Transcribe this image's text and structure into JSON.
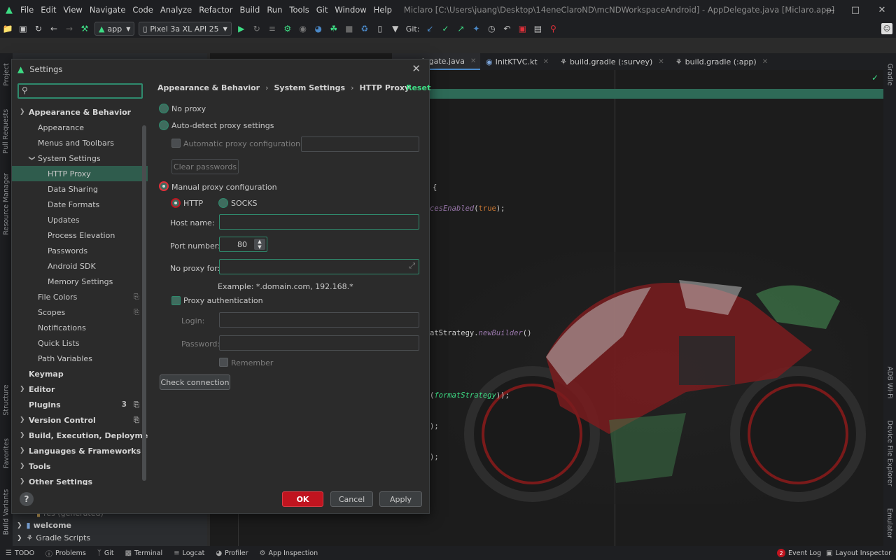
{
  "menubar": {
    "items": [
      "File",
      "Edit",
      "View",
      "Navigate",
      "Code",
      "Analyze",
      "Refactor",
      "Build",
      "Run",
      "Tools",
      "Git",
      "Window",
      "Help"
    ],
    "title": "Miclaro [C:\\Users\\juang\\Desktop\\14eneClaroND\\mcNDWorkspaceAndroid] - AppDelegate.java [Miclaro.app]"
  },
  "toolbar": {
    "module": "app",
    "device": "Pixel 3a XL API 25",
    "git_label": "Git:"
  },
  "left_stripe": [
    "Project",
    "Pull Requests",
    "Resource Manager",
    "Structure",
    "Favorites",
    "Build Variants"
  ],
  "right_stripe": [
    "Gradle",
    "ADB Wi-Fi",
    "Device File Explorer",
    "Emulator"
  ],
  "editor_tabs": [
    {
      "label": "elegate.java"
    },
    {
      "label": "InitKTVC.kt"
    },
    {
      "label": "build.gradle (:survey)"
    },
    {
      "label": "build.gradle (:app)"
    }
  ],
  "code_lines": [
    {
      "text": "{"
    },
    {
      "text": "cesEnabled(true);"
    },
    {
      "text": "atStrategy.newBuilder()"
    },
    {
      "text": "(formatStrategy));"
    },
    {
      "text": ");"
    },
    {
      "text": ");"
    }
  ],
  "project_tree": {
    "res_generated": "res (generated)",
    "welcome": "welcome",
    "gradle_scripts": "Gradle Scripts"
  },
  "dialog": {
    "title": "Settings",
    "sidebar": [
      {
        "label": "Appearance & Behavior",
        "bold": true,
        "expanded": true
      },
      {
        "label": "Appearance"
      },
      {
        "label": "Menus and Toolbars"
      },
      {
        "label": "System Settings",
        "expanded": true
      },
      {
        "label": "HTTP Proxy",
        "selected": true
      },
      {
        "label": "Data Sharing"
      },
      {
        "label": "Date Formats"
      },
      {
        "label": "Updates"
      },
      {
        "label": "Process Elevation"
      },
      {
        "label": "Passwords"
      },
      {
        "label": "Android SDK"
      },
      {
        "label": "Memory Settings"
      },
      {
        "label": "File Colors"
      },
      {
        "label": "Scopes"
      },
      {
        "label": "Notifications"
      },
      {
        "label": "Quick Lists"
      },
      {
        "label": "Path Variables"
      },
      {
        "label": "Keymap",
        "bold": true
      },
      {
        "label": "Editor",
        "bold": true
      },
      {
        "label": "Plugins",
        "bold": true,
        "count": "3"
      },
      {
        "label": "Version Control",
        "bold": true
      },
      {
        "label": "Build, Execution, Deployment",
        "bold": true
      },
      {
        "label": "Languages & Frameworks",
        "bold": true
      },
      {
        "label": "Tools",
        "bold": true
      },
      {
        "label": "Other Settings",
        "bold": true
      }
    ],
    "breadcrumb": [
      "Appearance & Behavior",
      "System Settings",
      "HTTP Proxy"
    ],
    "reset": "Reset",
    "no_proxy": "No proxy",
    "auto_detect": "Auto-detect proxy settings",
    "auto_config_url": "Automatic proxy configuration URL:",
    "clear_passwords": "Clear passwords",
    "manual": "Manual proxy configuration",
    "http": "HTTP",
    "socks": "SOCKS",
    "host_name_label": "Host name:",
    "host_name_value": "",
    "port_label": "Port number:",
    "port_value": "80",
    "no_proxy_for_label": "No proxy for:",
    "no_proxy_for_value": "",
    "example": "Example: *.domain.com, 192.168.*",
    "proxy_auth": "Proxy authentication",
    "login_label": "Login:",
    "password_label": "Password:",
    "remember": "Remember",
    "check_connection": "Check connection",
    "ok": "OK",
    "cancel": "Cancel",
    "apply": "Apply"
  },
  "statusbar": {
    "items": [
      "TODO",
      "Problems",
      "Git",
      "Terminal",
      "Logcat",
      "Profiler",
      "App Inspection"
    ],
    "event_log": "Event Log",
    "event_count": "2",
    "layout_inspector": "Layout Inspector"
  },
  "colors": {
    "accent_green": "#3ddc84",
    "selection": "#2f5c4d",
    "ok_red": "#c0141f"
  }
}
